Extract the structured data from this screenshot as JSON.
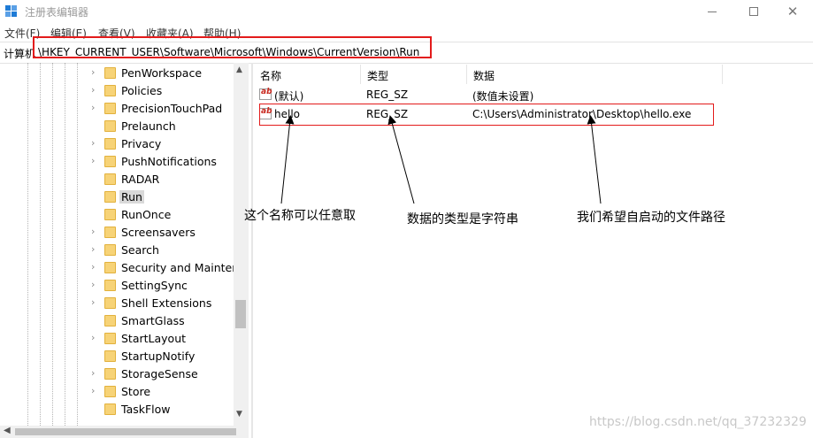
{
  "window": {
    "title": "注册表编辑器"
  },
  "menu": [
    "文件(F)",
    "编辑(E)",
    "查看(V)",
    "收藏夹(A)",
    "帮助(H)"
  ],
  "address": {
    "label": "计算机",
    "path": "\\HKEY_CURRENT_USER\\Software\\Microsoft\\Windows\\CurrentVersion\\Run"
  },
  "tree": {
    "items": [
      {
        "label": "PenWorkspace",
        "expandable": true
      },
      {
        "label": "Policies",
        "expandable": true
      },
      {
        "label": "PrecisionTouchPad",
        "expandable": true
      },
      {
        "label": "Prelaunch",
        "expandable": false
      },
      {
        "label": "Privacy",
        "expandable": true
      },
      {
        "label": "PushNotifications",
        "expandable": true
      },
      {
        "label": "RADAR",
        "expandable": false
      },
      {
        "label": "Run",
        "expandable": false,
        "selected": true
      },
      {
        "label": "RunOnce",
        "expandable": false
      },
      {
        "label": "Screensavers",
        "expandable": true
      },
      {
        "label": "Search",
        "expandable": true
      },
      {
        "label": "Security and Maintena",
        "expandable": true
      },
      {
        "label": "SettingSync",
        "expandable": true
      },
      {
        "label": "Shell Extensions",
        "expandable": true
      },
      {
        "label": "SmartGlass",
        "expandable": false
      },
      {
        "label": "StartLayout",
        "expandable": true
      },
      {
        "label": "StartupNotify",
        "expandable": false
      },
      {
        "label": "StorageSense",
        "expandable": true
      },
      {
        "label": "Store",
        "expandable": true
      },
      {
        "label": "TaskFlow",
        "expandable": false
      }
    ]
  },
  "columns": {
    "name": "名称",
    "type": "类型",
    "data": "数据"
  },
  "values": [
    {
      "name": "(默认)",
      "type": "REG_SZ",
      "data": "(数值未设置)"
    },
    {
      "name": "hello",
      "type": "REG_SZ",
      "data": "C:\\Users\\Administrator\\Desktop\\hello.exe"
    }
  ],
  "annotations": {
    "name_note": "这个名称可以任意取",
    "type_note": "数据的类型是字符串",
    "path_note": "我们希望自启动的文件路径"
  },
  "watermark": "https://blog.csdn.net/qq_37232329",
  "colors": {
    "highlight": "#e31b1b",
    "folder": "#f7d377",
    "selected": "#d9d9d9"
  }
}
